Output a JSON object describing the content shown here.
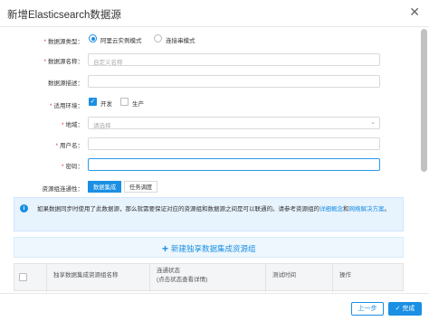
{
  "dialog": {
    "title": "新增Elasticsearch数据源",
    "close_icon": "close-icon"
  },
  "form": {
    "source_type": {
      "label": "数据源类型：",
      "required": true,
      "options": [
        {
          "label": "阿里云实例模式",
          "selected": true
        },
        {
          "label": "连接串模式",
          "selected": false
        }
      ]
    },
    "name": {
      "label": "数据源名称：",
      "required": true,
      "placeholder": "自定义名称",
      "value": ""
    },
    "description": {
      "label": "数据源描述：",
      "required": false,
      "value": ""
    },
    "environment": {
      "label": "适用环境：",
      "required": true,
      "options": [
        {
          "label": "开发",
          "checked": true
        },
        {
          "label": "生产",
          "checked": false
        }
      ]
    },
    "region": {
      "label": "地域：",
      "required": true,
      "placeholder": "请选择",
      "value": ""
    },
    "username": {
      "label": "用户名：",
      "required": true,
      "value": ""
    },
    "password": {
      "label": "密码：",
      "required": true,
      "value": ""
    },
    "connectivity": {
      "label": "资源组连通性：",
      "tabs": [
        {
          "label": "数据集成",
          "active": true
        },
        {
          "label": "任务调度",
          "active": false
        }
      ]
    }
  },
  "notice": {
    "text_main": "如果数据同步时使用了此数据源，那么就需要保证对应的资源组和数据源之间是可以联通的。请参考资源组的",
    "link1": "详细概念",
    "and": "和",
    "link2": "网络解决方案",
    "end": "。"
  },
  "add_resource_group": {
    "label": "新建独享数据集成资源组"
  },
  "table": {
    "columns": [
      {
        "label": "独享数据集成资源组名称"
      },
      {
        "label": "连通状态",
        "sub": "(点击状态查看详情)"
      },
      {
        "label": "测试时间"
      },
      {
        "label": "操作"
      }
    ]
  },
  "footer": {
    "prev_label": "上一步",
    "done_label": "完成",
    "done_icon": "check-icon"
  }
}
